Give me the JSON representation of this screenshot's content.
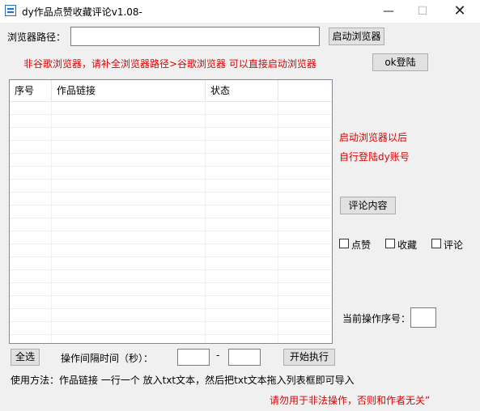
{
  "window": {
    "title": "dy作品点赞收藏评论v1.08-",
    "min_glyph": "—",
    "max_glyph": "☐",
    "close_glyph": "✕"
  },
  "browser": {
    "path_label": "浏览器路径：",
    "path_value": "",
    "launch_button": "启动浏览器",
    "hint": "非谷歌浏览器，请补全浏览器路径>谷歌浏览器 可以直接启动浏览器",
    "ok_login_button": "ok登陆"
  },
  "table": {
    "columns": [
      "序号",
      "作品链接",
      "状态"
    ],
    "rows": []
  },
  "sidebar": {
    "note_line1": "启动浏览器以后",
    "note_line2": "自行登陆dy账号",
    "comment_button": "评论内容",
    "options": [
      {
        "label": "点赞",
        "checked": false
      },
      {
        "label": "收藏",
        "checked": false
      },
      {
        "label": "评论",
        "checked": false
      }
    ],
    "current_index_label": "当前操作序号：",
    "current_index_value": ""
  },
  "footer": {
    "select_all_button": "全选",
    "interval_label": "操作间隔时间（秒）：",
    "interval_from": "",
    "dash": "-",
    "interval_to": "",
    "start_button": "开始执行",
    "usage": "使用方法：作品链接 一行一个 放入txt文本，然后把txt文本拖入列表框即可导入",
    "warning": "请勿用于非法操作，否则和作者无关”"
  }
}
